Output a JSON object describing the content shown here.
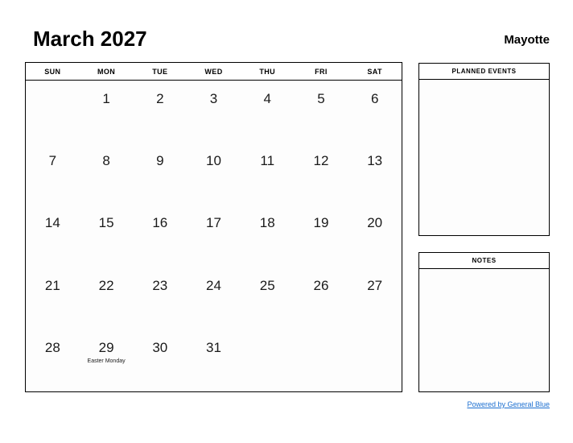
{
  "header": {
    "month_title": "March 2027",
    "region": "Mayotte"
  },
  "calendar": {
    "weekdays": [
      "SUN",
      "MON",
      "TUE",
      "WED",
      "THU",
      "FRI",
      "SAT"
    ],
    "weeks": [
      [
        {
          "day": "",
          "event": ""
        },
        {
          "day": "1",
          "event": ""
        },
        {
          "day": "2",
          "event": ""
        },
        {
          "day": "3",
          "event": ""
        },
        {
          "day": "4",
          "event": ""
        },
        {
          "day": "5",
          "event": ""
        },
        {
          "day": "6",
          "event": ""
        }
      ],
      [
        {
          "day": "7",
          "event": ""
        },
        {
          "day": "8",
          "event": ""
        },
        {
          "day": "9",
          "event": ""
        },
        {
          "day": "10",
          "event": ""
        },
        {
          "day": "11",
          "event": ""
        },
        {
          "day": "12",
          "event": ""
        },
        {
          "day": "13",
          "event": ""
        }
      ],
      [
        {
          "day": "14",
          "event": ""
        },
        {
          "day": "15",
          "event": ""
        },
        {
          "day": "16",
          "event": ""
        },
        {
          "day": "17",
          "event": ""
        },
        {
          "day": "18",
          "event": ""
        },
        {
          "day": "19",
          "event": ""
        },
        {
          "day": "20",
          "event": ""
        }
      ],
      [
        {
          "day": "21",
          "event": ""
        },
        {
          "day": "22",
          "event": ""
        },
        {
          "day": "23",
          "event": ""
        },
        {
          "day": "24",
          "event": ""
        },
        {
          "day": "25",
          "event": ""
        },
        {
          "day": "26",
          "event": ""
        },
        {
          "day": "27",
          "event": ""
        }
      ],
      [
        {
          "day": "28",
          "event": ""
        },
        {
          "day": "29",
          "event": "Easter Monday"
        },
        {
          "day": "30",
          "event": ""
        },
        {
          "day": "31",
          "event": ""
        },
        {
          "day": "",
          "event": ""
        },
        {
          "day": "",
          "event": ""
        },
        {
          "day": "",
          "event": ""
        }
      ]
    ]
  },
  "panels": {
    "planned_events_title": "PLANNED EVENTS",
    "notes_title": "NOTES"
  },
  "footer": {
    "link_text": "Powered by General Blue"
  },
  "colors": {
    "link": "#1c6fd0",
    "border": "#000000",
    "text": "#111111",
    "page_background": "#ffffff",
    "cell_background": "#fdfdfd"
  }
}
